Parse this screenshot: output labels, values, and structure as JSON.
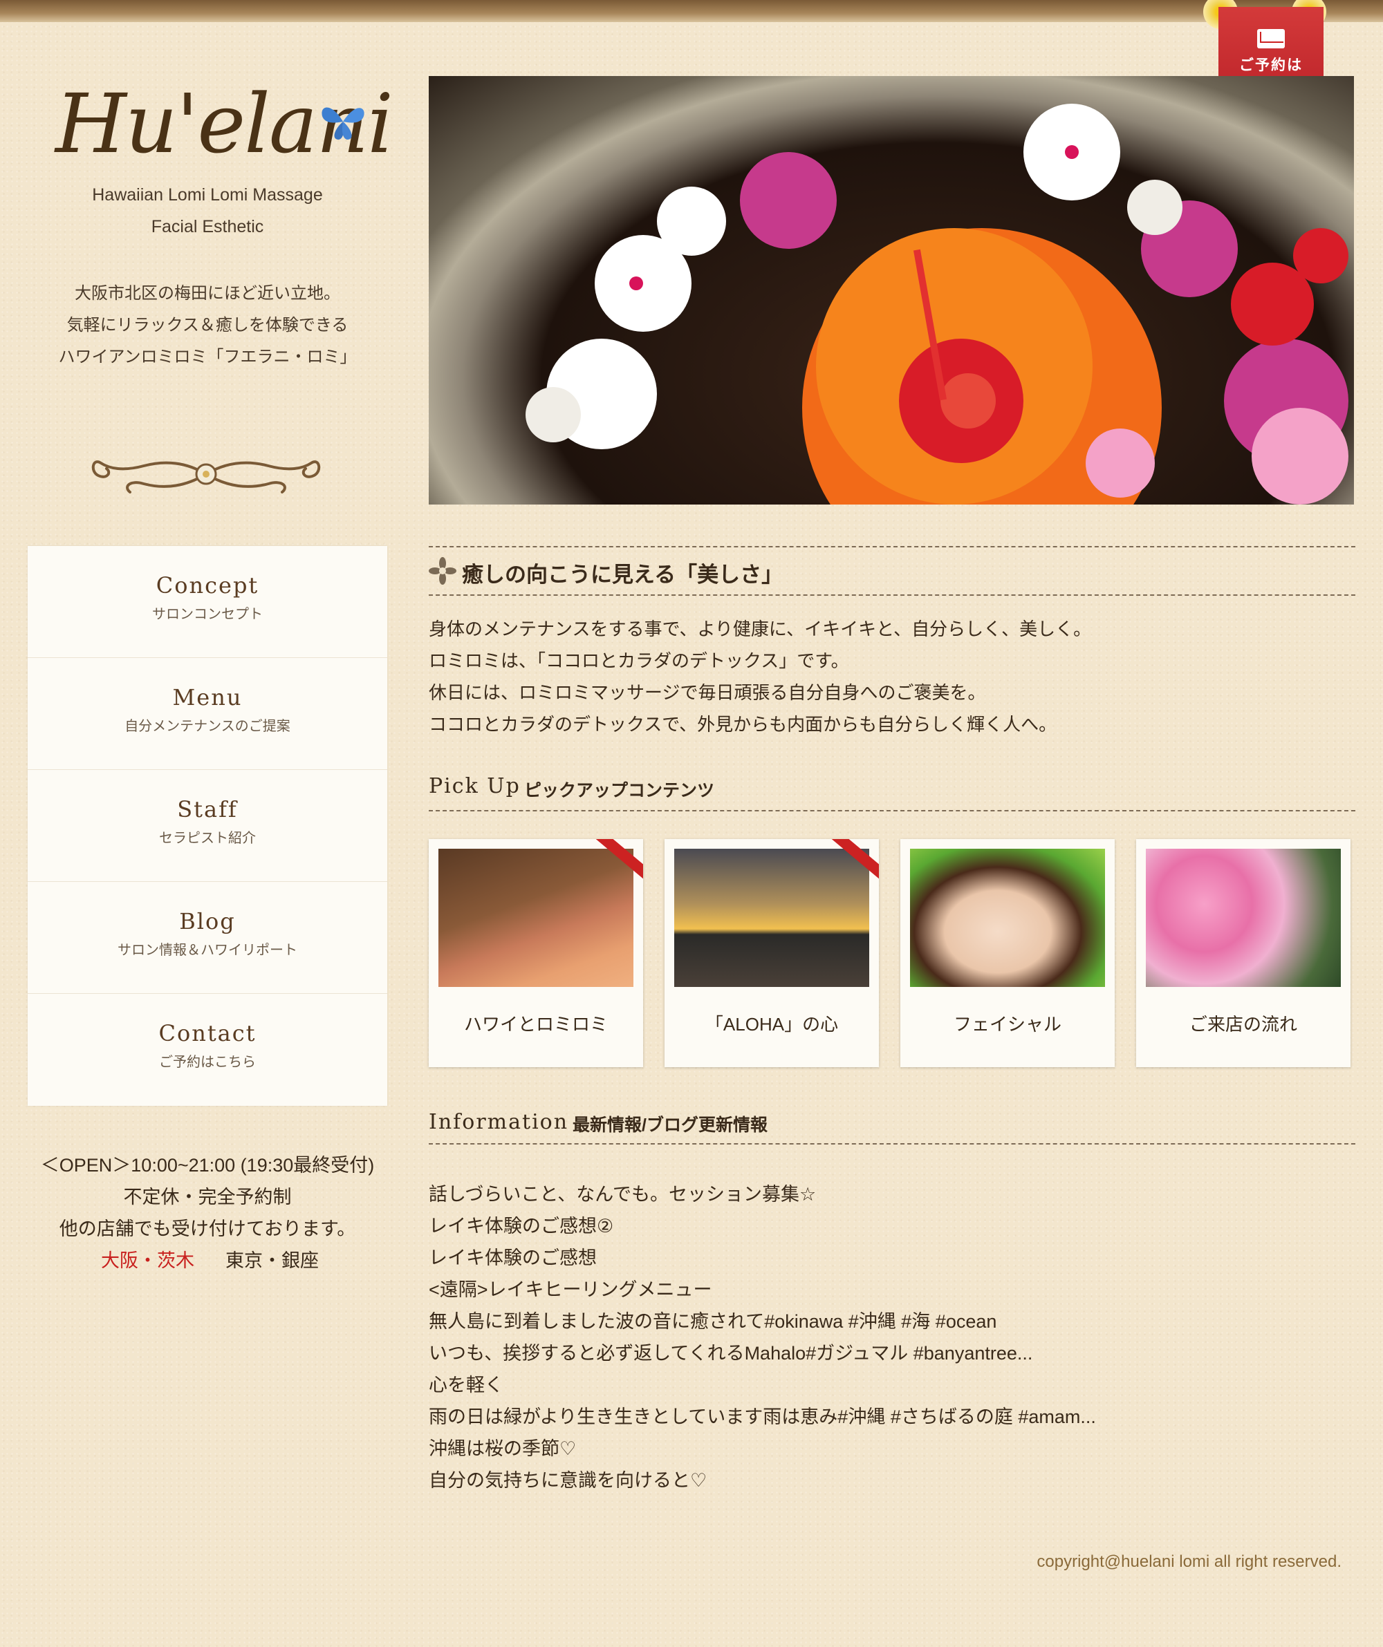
{
  "reserve": {
    "label": "ご予約は\nこちら"
  },
  "logo": {
    "text": "Hu'elani"
  },
  "tagline": [
    "Hawaiian Lomi Lomi Massage",
    "Facial Esthetic"
  ],
  "intro": [
    "大阪市北区の梅田にほど近い立地。",
    "気軽にリラックス＆癒しを体験できる",
    "ハワイアンロミロミ「フエラニ・ロミ」"
  ],
  "nav": [
    {
      "en": "Concept",
      "ja": "サロンコンセプト"
    },
    {
      "en": "Menu",
      "ja": "自分メンテナンスのご提案"
    },
    {
      "en": "Staff",
      "ja": "セラピスト紹介"
    },
    {
      "en": "Blog",
      "ja": "サロン情報＆ハワイリポート"
    },
    {
      "en": "Contact",
      "ja": "ご予約はこちら"
    }
  ],
  "hours": {
    "open": "＜OPEN＞10:00~21:00 (19:30最終受付)",
    "holiday": "不定休・完全予約制",
    "other": "他の店舗でも受け付けております。",
    "locations": [
      "大阪・茨木",
      "東京・銀座"
    ]
  },
  "concept": {
    "heading": "癒しの向こうに見える「美しさ」",
    "lines": [
      "身体のメンテナンスをする事で、より健康に、イキイキと、自分らしく、美しく。",
      "ロミロミは、「ココロとカラダのデトックス」です。",
      "休日には、ロミロミマッサージで毎日頑張る自分自身へのご褒美を。",
      "ココロとカラダのデトックスで、外見からも内面からも自分らしく輝く人へ。"
    ]
  },
  "pickup": {
    "en": "Pick Up",
    "ja": "ピックアップコンテンツ",
    "cards": [
      "ハワイとロミロミ",
      "「ALOHA」の心",
      "フェイシャル",
      "ご来店の流れ"
    ]
  },
  "information": {
    "en": "Information",
    "ja": "最新情報/ブログ更新情報",
    "items": [
      "話しづらいこと、なんでも。セッション募集☆",
      "レイキ体験のご感想②",
      "レイキ体験のご感想",
      "<遠隔>レイキヒーリングメニュー",
      "無人島に到着しました波の音に癒されて#okinawa #沖縄 #海 #ocean",
      "いつも、挨拶すると必ず返してくれるMahalo#ガジュマル #banyantree...",
      "心を軽く",
      "雨の日は緑がより生き生きとしています雨は恵み#沖縄 #さちばるの庭 #amam...",
      "沖縄は桜の季節♡",
      "自分の気持ちに意識を向けると♡"
    ]
  },
  "copyright": "copyright@huelani lomi all right reserved.",
  "colors": {
    "background": "#f3e6cd",
    "accent_red": "#c8201e",
    "text": "#3a2a1a"
  }
}
